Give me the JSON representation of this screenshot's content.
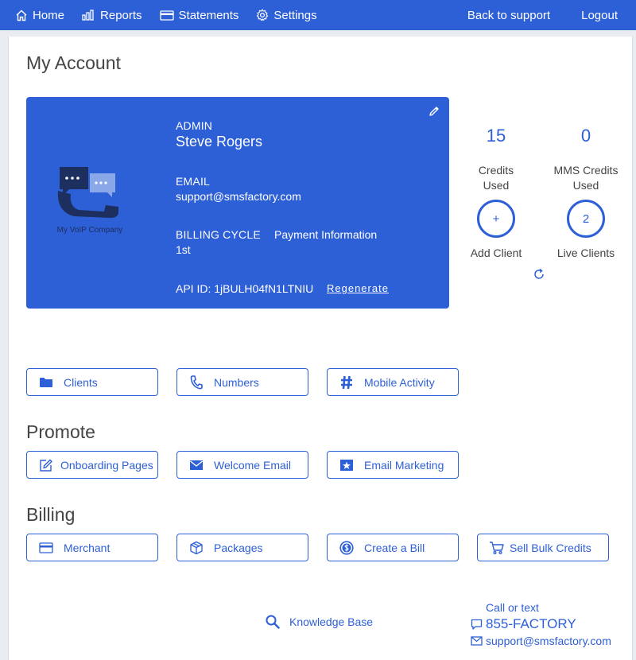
{
  "nav": {
    "home": "Home",
    "reports": "Reports",
    "statements": "Statements",
    "settings": "Settings",
    "back_to_support": "Back to support",
    "logout": "Logout"
  },
  "page": {
    "title": "My Account"
  },
  "account_card": {
    "logo_caption": "My VoIP Company",
    "role_label": "ADMIN",
    "name": "Steve Rogers",
    "email_label": "EMAIL",
    "email": "support@smsfactory.com",
    "billing_cycle_label": "BILLING CYCLE",
    "billing_cycle": "1st",
    "payment_info": "Payment Information",
    "api_id": "API ID: 1jBULH04fN1LTNIU",
    "regenerate": "Regenerate"
  },
  "stats": {
    "credits_used_value": "15",
    "credits_used_label": "Credits Used",
    "mms_credits_value": "0",
    "mms_credits_label": "MMS Credits Used",
    "add_client_symbol": "+",
    "add_client_label": "Add Client",
    "live_clients_value": "2",
    "live_clients_label": "Live Clients"
  },
  "actions": {
    "clients": "Clients",
    "numbers": "Numbers",
    "mobile_activity": "Mobile Activity"
  },
  "promote": {
    "title": "Promote",
    "onboarding_pages": "Onboarding Pages",
    "welcome_email": "Welcome Email",
    "email_marketing": "Email Marketing"
  },
  "billing": {
    "title": "Billing",
    "merchant": "Merchant",
    "packages": "Packages",
    "create_bill": "Create a Bill",
    "sell_bulk_credits": "Sell Bulk Credits"
  },
  "footer": {
    "knowledge_base": "Knowledge Base",
    "call_or_text": "Call or text",
    "phone": "855-FACTORY",
    "email": "support@smsfactory.com"
  },
  "colors": {
    "primary": "#2d5fd6",
    "logo_dark": "#1d2f5e",
    "logo_light": "#8aa8e8"
  }
}
